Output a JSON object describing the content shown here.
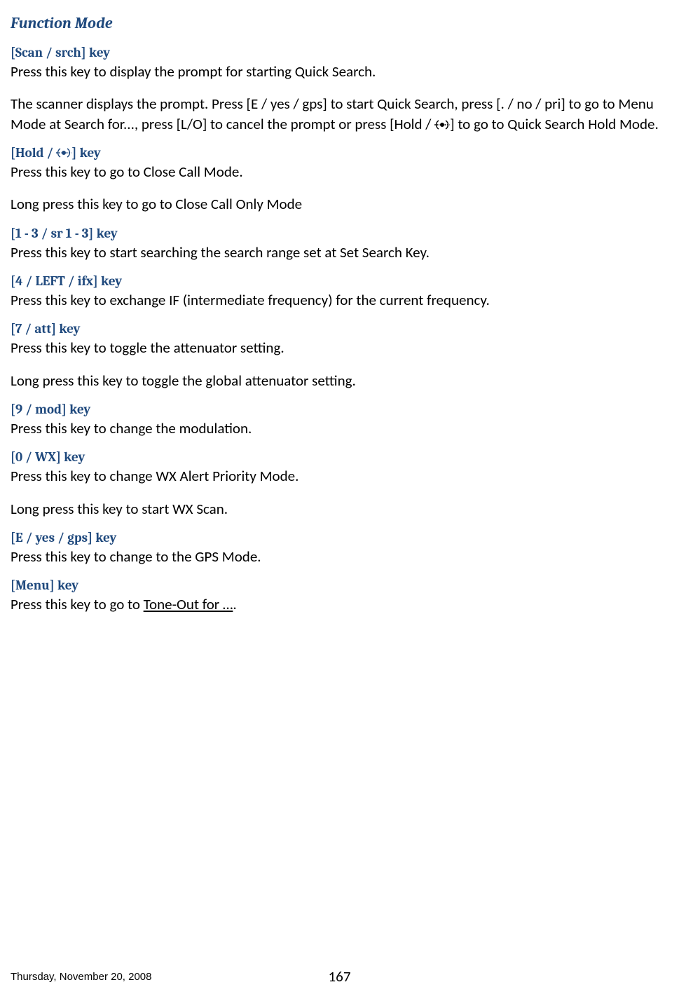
{
  "section_title": "Function Mode",
  "scan_srch": {
    "heading": "[Scan / srch] key",
    "line1": "Press this key to display the prompt for starting Quick Search.",
    "para2_a": "The scanner displays the prompt. Press [E / yes / gps] to start Quick Search, press [. / no / pri] to go to Menu Mode at Search for..., press [L/O] to cancel the prompt or press [Hold / ",
    "para2_b": "] to go to Quick Search Hold Mode."
  },
  "hold": {
    "heading_a": " [Hold / ",
    "heading_b": "] key",
    "line1": "Press this key to go to Close Call Mode.",
    "line2": "Long press this key to go to Close Call Only Mode"
  },
  "sr13": {
    "heading": "[1 - 3 / sr 1 - 3] key",
    "line1": "Press this key to start searching the search range set at Set Search Key."
  },
  "left_ifx": {
    "heading": "[4 / LEFT / ifx] key",
    "line1": "Press this key to exchange IF (intermediate frequency) for the current frequency."
  },
  "att": {
    "heading": " [7 / att] key",
    "line1": "Press this key to toggle the attenuator setting.",
    "line2": "Long press this key to toggle the global attenuator setting."
  },
  "mod": {
    "heading": "[9 / mod] key",
    "line1": "Press this key to change the modulation."
  },
  "wx": {
    "heading": "[0 / WX] key",
    "line1": "Press this key to change WX Alert Priority Mode.",
    "line2": "Long press this key to start WX Scan."
  },
  "gps": {
    "heading": "[E / yes / gps] key",
    "line1": " Press this key to change to the GPS Mode."
  },
  "menu": {
    "heading": "[Menu] key",
    "line1_a": "Press this key to go to ",
    "link": "Tone-Out for …",
    "line1_b": "."
  },
  "footer": {
    "date": "Thursday, November 20, 2008",
    "page": "167"
  }
}
